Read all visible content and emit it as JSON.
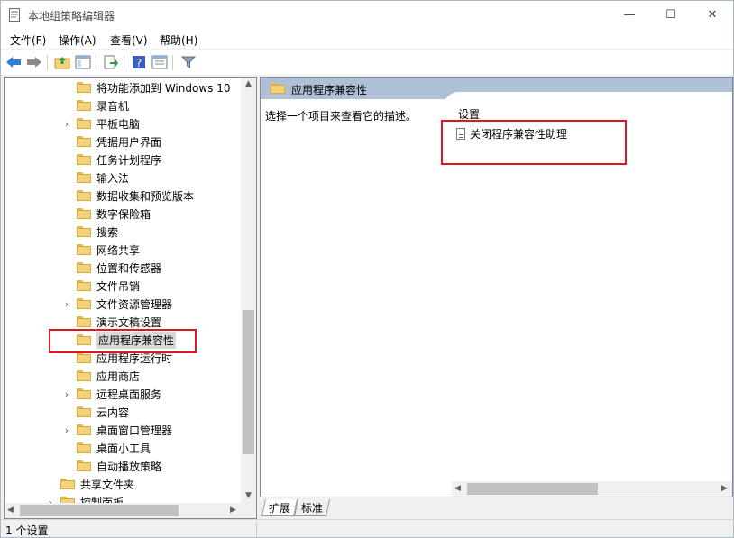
{
  "window": {
    "title": "本地组策略编辑器"
  },
  "title_buttons": {
    "minimize": "—",
    "maximize": "☐",
    "close": "✕"
  },
  "menu": [
    "文件(F)",
    "操作(A)",
    "查看(V)",
    "帮助(H)"
  ],
  "toolbar_icons": [
    "back-arrow-icon",
    "forward-arrow-icon",
    "folder-up-icon",
    "show-hide-tree-icon",
    "export-list-icon",
    "help-icon",
    "properties-view-icon",
    "filter-icon"
  ],
  "tree": {
    "items": [
      {
        "label": "将功能添加到 Windows 10",
        "expandable": false
      },
      {
        "label": "录音机",
        "expandable": false
      },
      {
        "label": "平板电脑",
        "expandable": true
      },
      {
        "label": "凭据用户界面",
        "expandable": false
      },
      {
        "label": "任务计划程序",
        "expandable": false
      },
      {
        "label": "输入法",
        "expandable": false
      },
      {
        "label": "数据收集和预览版本",
        "expandable": false
      },
      {
        "label": "数字保险箱",
        "expandable": false
      },
      {
        "label": "搜索",
        "expandable": false
      },
      {
        "label": "网络共享",
        "expandable": false
      },
      {
        "label": "位置和传感器",
        "expandable": false
      },
      {
        "label": "文件吊销",
        "expandable": false
      },
      {
        "label": "文件资源管理器",
        "expandable": true
      },
      {
        "label": "演示文稿设置",
        "expandable": false
      },
      {
        "label": "应用程序兼容性",
        "expandable": false,
        "selected": true
      },
      {
        "label": "应用程序运行时",
        "expandable": false
      },
      {
        "label": "应用商店",
        "expandable": false
      },
      {
        "label": "远程桌面服务",
        "expandable": true
      },
      {
        "label": "云内容",
        "expandable": false
      },
      {
        "label": "桌面窗口管理器",
        "expandable": true
      },
      {
        "label": "桌面小工具",
        "expandable": false
      },
      {
        "label": "自动播放策略",
        "expandable": false
      },
      {
        "label": "共享文件夹",
        "expandable": false,
        "level": 1
      },
      {
        "label": "控制面板",
        "expandable": true,
        "level": 1
      }
    ]
  },
  "right_pane": {
    "header": "应用程序兼容性",
    "description": "选择一个项目来查看它的描述。",
    "settings_header": "设置",
    "settings": [
      "关闭程序兼容性助理"
    ]
  },
  "tabs": [
    "扩展",
    "标准"
  ],
  "status": {
    "text": "1 个设置"
  },
  "colors": {
    "highlight_box": "#e2141e",
    "header_band": "#aebfd6",
    "selection": "#d9d9d9"
  }
}
